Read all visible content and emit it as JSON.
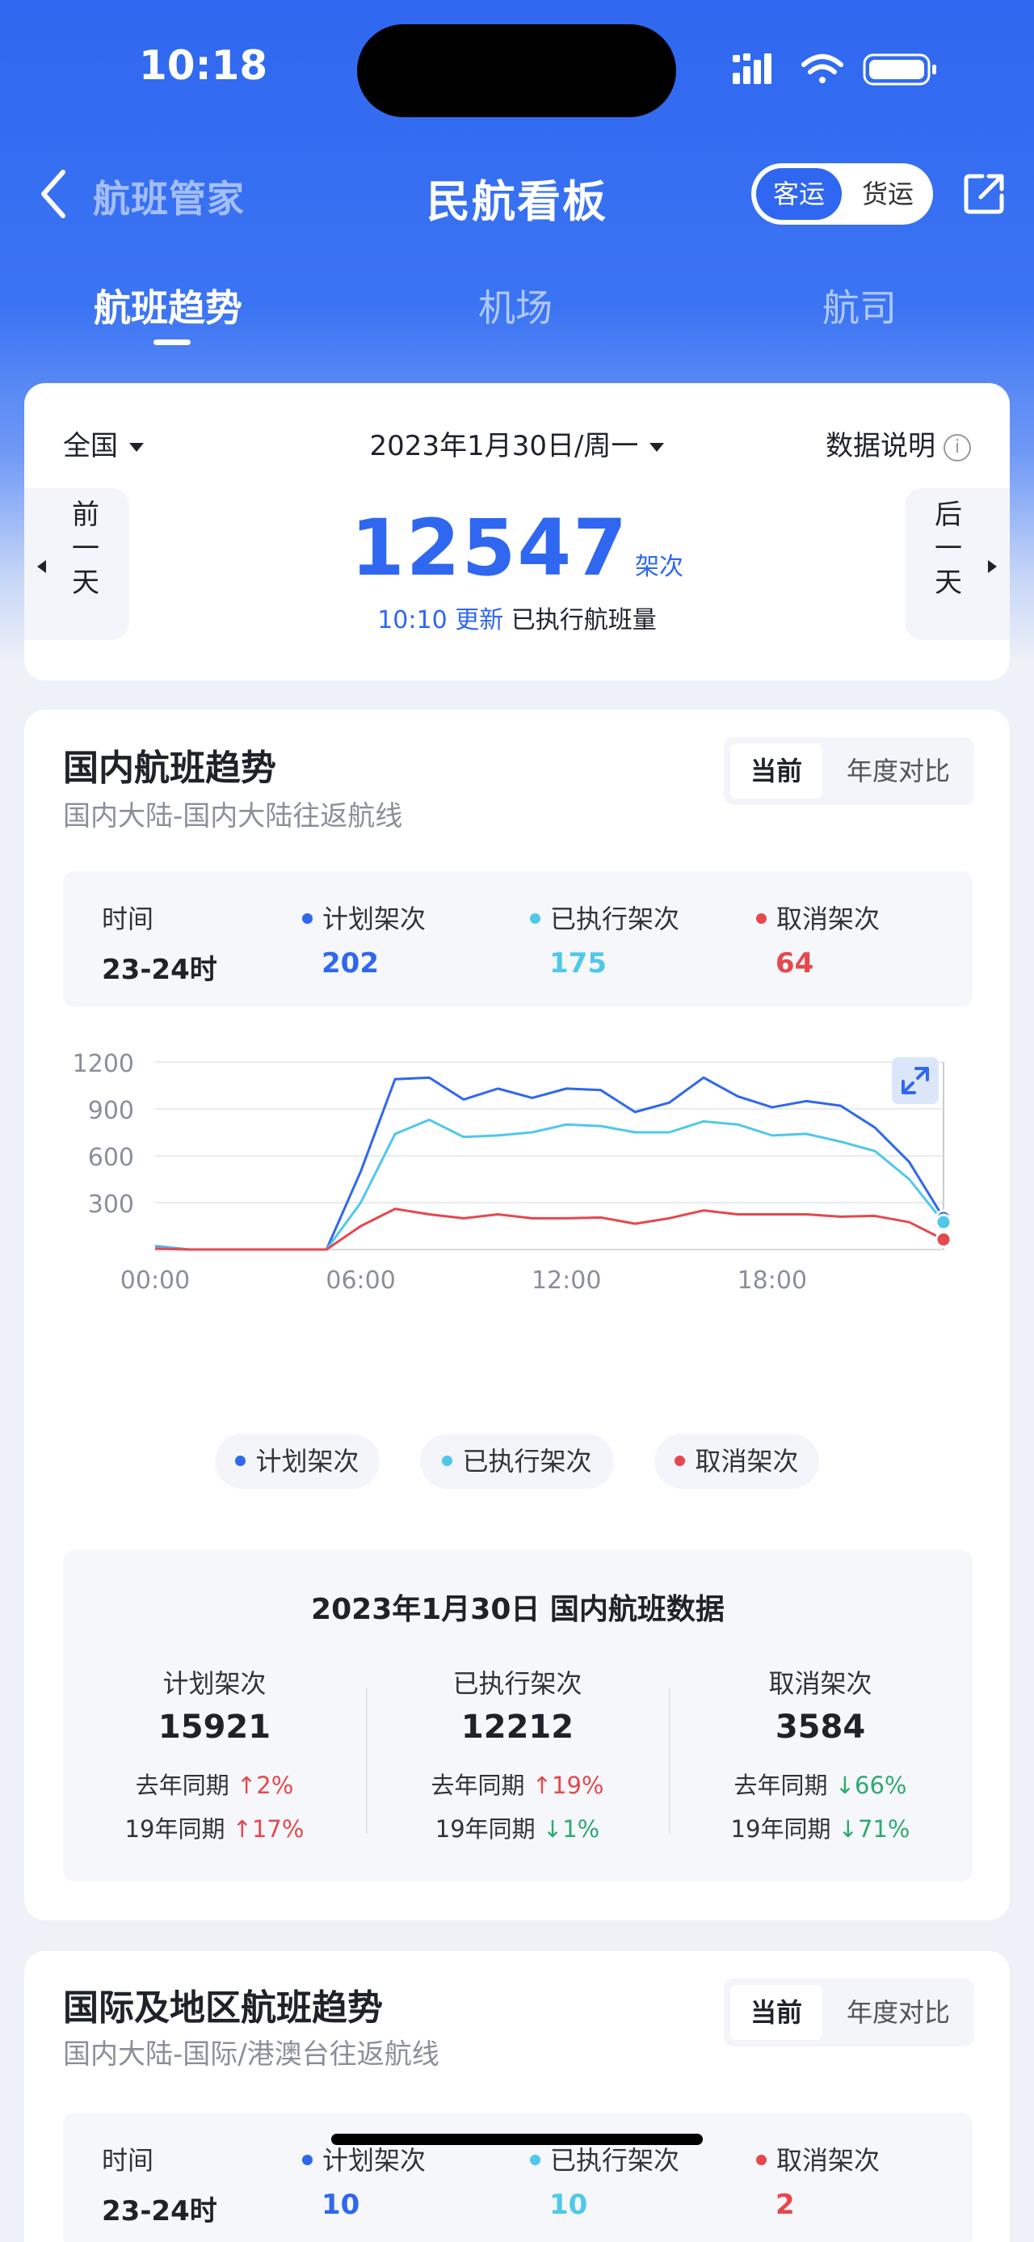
{
  "status_bar": {
    "time": "10:18"
  },
  "nav": {
    "back_label": "航班管家",
    "title": "民航看板",
    "mode_options": [
      "客运",
      "货运"
    ],
    "mode_selected": "客运"
  },
  "tabs": [
    {
      "label": "航班趋势",
      "active": true
    },
    {
      "label": "机场",
      "active": false
    },
    {
      "label": "航司",
      "active": false
    }
  ],
  "overview": {
    "region": "全国",
    "date": "2023年1月30日/周一",
    "data_note": "数据说明",
    "info_glyph": "i",
    "prev_day": [
      "前",
      "一",
      "天"
    ],
    "next_day": [
      "后",
      "一",
      "天"
    ],
    "count": "12547",
    "count_unit": "架次",
    "update_time": "10:10 更新",
    "count_desc": "已执行航班量"
  },
  "domestic": {
    "title": "国内航班趋势",
    "subtitle": "国内大陆-国内大陆往返航线",
    "toggle": [
      "当前",
      "年度对比"
    ],
    "tooltip": {
      "time_label": "时间",
      "time_value": "23-24时",
      "planned_label": "计划架次",
      "planned_value": "202",
      "executed_label": "已执行架次",
      "executed_value": "175",
      "cancelled_label": "取消架次",
      "cancelled_value": "64"
    },
    "legend": [
      "计划架次",
      "已执行架次",
      "取消架次"
    ],
    "summary": {
      "title": "2023年1月30日 国内航班数据",
      "columns": [
        {
          "label": "计划架次",
          "value": "15921",
          "yoy_label": "去年同期",
          "yoy": "↑2%",
          "yoy_dir": "up",
          "vs19_label": "19年同期",
          "vs19": "↑17%",
          "vs19_dir": "up"
        },
        {
          "label": "已执行架次",
          "value": "12212",
          "yoy_label": "去年同期",
          "yoy": "↑19%",
          "yoy_dir": "up",
          "vs19_label": "19年同期",
          "vs19": "↓1%",
          "vs19_dir": "down"
        },
        {
          "label": "取消架次",
          "value": "3584",
          "yoy_label": "去年同期",
          "yoy": "↓66%",
          "yoy_dir": "down",
          "vs19_label": "19年同期",
          "vs19": "↓71%",
          "vs19_dir": "down"
        }
      ]
    }
  },
  "international": {
    "title": "国际及地区航班趋势",
    "subtitle": "国内大陆-国际/港澳台往返航线",
    "toggle": [
      "当前",
      "年度对比"
    ],
    "tooltip": {
      "time_label": "时间",
      "time_value": "23-24时",
      "planned_label": "计划架次",
      "planned_value": "10",
      "executed_label": "已执行架次",
      "executed_value": "10",
      "cancelled_label": "取消架次",
      "cancelled_value": "2"
    }
  },
  "colors": {
    "planned": "#2f67f0",
    "executed": "#4fc8ea",
    "cancelled": "#e5484d"
  },
  "chart_data": {
    "type": "line",
    "x": [
      "00:00",
      "01:00",
      "02:00",
      "03:00",
      "04:00",
      "05:00",
      "06:00",
      "07:00",
      "08:00",
      "09:00",
      "10:00",
      "11:00",
      "12:00",
      "13:00",
      "14:00",
      "15:00",
      "16:00",
      "17:00",
      "18:00",
      "19:00",
      "20:00",
      "21:00",
      "22:00",
      "23:00"
    ],
    "x_ticks": [
      "00:00",
      "06:00",
      "12:00",
      "18:00"
    ],
    "y_ticks": [
      "1200",
      "900",
      "600",
      "300"
    ],
    "ylim": [
      0,
      1200
    ],
    "series": [
      {
        "name": "计划架次",
        "color": "#2f67f0",
        "values": [
          20,
          0,
          0,
          0,
          0,
          0,
          500,
          1090,
          1100,
          960,
          1030,
          970,
          1030,
          1020,
          880,
          940,
          1100,
          980,
          910,
          950,
          920,
          780,
          560,
          202
        ]
      },
      {
        "name": "已执行架次",
        "color": "#4fc8ea",
        "values": [
          15,
          0,
          0,
          0,
          0,
          0,
          300,
          740,
          830,
          720,
          730,
          750,
          800,
          790,
          750,
          750,
          820,
          800,
          730,
          740,
          690,
          630,
          450,
          175
        ]
      },
      {
        "name": "取消架次",
        "color": "#e5484d",
        "values": [
          5,
          0,
          0,
          0,
          0,
          0,
          150,
          260,
          225,
          200,
          225,
          200,
          200,
          205,
          165,
          200,
          250,
          225,
          225,
          225,
          210,
          215,
          175,
          64
        ]
      }
    ],
    "grid": true,
    "legend_position": "bottom"
  }
}
